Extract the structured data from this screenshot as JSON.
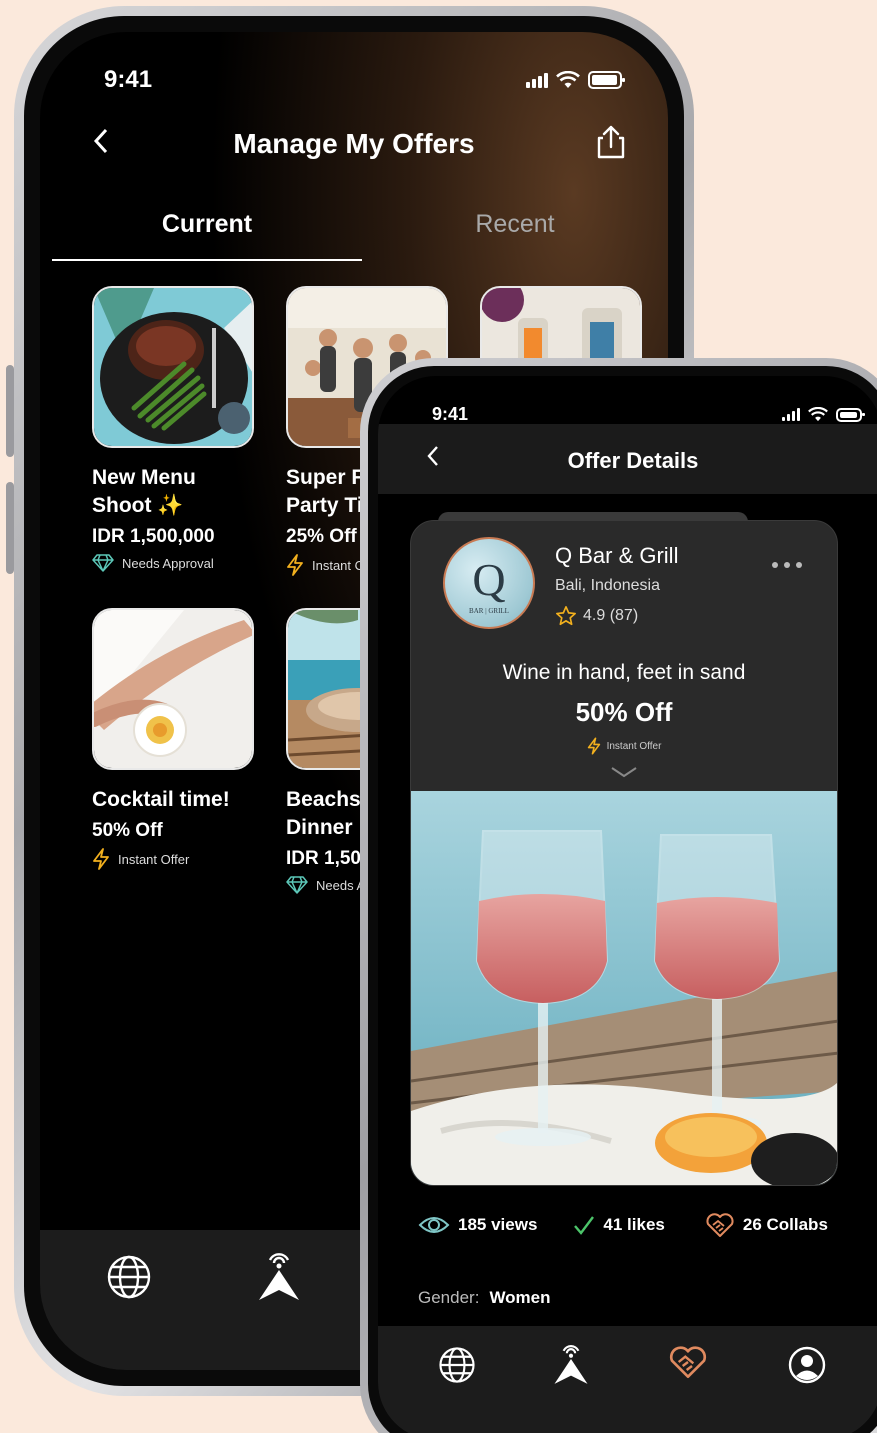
{
  "back_phone": {
    "status": {
      "time": "9:41"
    },
    "header": {
      "title": "Manage My Offers"
    },
    "tabs": [
      {
        "label": "Current",
        "active": true
      },
      {
        "label": "Recent",
        "active": false
      }
    ],
    "offers": [
      {
        "title": "New Menu\nShoot ✨",
        "price": "IDR 1,500,000",
        "badge": "Needs Approval",
        "badge_icon": "diamond-icon"
      },
      {
        "title": "Super F\nParty Ti",
        "price": "25% Off",
        "badge": "Instant O",
        "badge_icon": "lightning-icon"
      },
      {
        "title": "",
        "price": "",
        "badge": "",
        "badge_icon": ""
      },
      {
        "title": "Cocktail time!",
        "price": "50% Off",
        "badge": "Instant Offer",
        "badge_icon": "lightning-icon"
      },
      {
        "title": "Beachs\nDinner",
        "price": "IDR 1,50",
        "badge": "Needs Ap",
        "badge_icon": "diamond-icon"
      }
    ],
    "nav": [
      "globe-icon",
      "tower-icon"
    ]
  },
  "front_phone": {
    "status": {
      "time": "9:41"
    },
    "header": {
      "title": "Offer Details"
    },
    "venue": {
      "name": "Q Bar & Grill",
      "location": "Bali, Indonesia",
      "rating": "4.9 (87)",
      "logo_letter": "Q",
      "logo_sub": "BAR | GRILL"
    },
    "offer": {
      "tagline": "Wine in hand, feet in sand",
      "discount": "50% Off",
      "type": "Instant Offer"
    },
    "stats": {
      "views": "185 views",
      "likes": "41 likes",
      "collabs": "26 Collabs"
    },
    "gender": {
      "label": "Gender:",
      "value": "Women"
    },
    "nav": [
      "globe-icon",
      "tower-icon",
      "handshake-heart-icon",
      "profile-icon"
    ]
  },
  "colors": {
    "accent": "#e08a5f",
    "gold": "#f2b01e",
    "check": "#4cc46a",
    "eye": "#7fc6c6",
    "background": "#fbe9dc"
  }
}
